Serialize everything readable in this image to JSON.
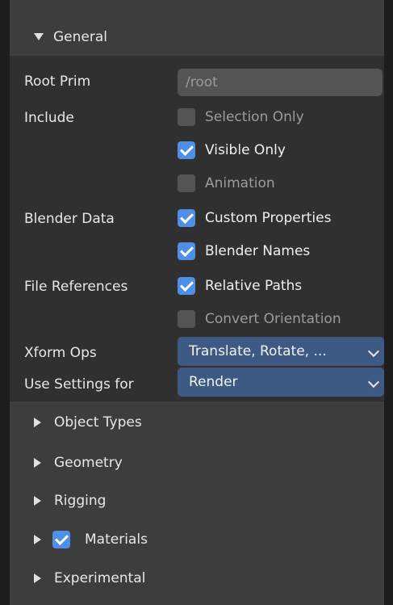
{
  "header": {
    "title": "General"
  },
  "fields": {
    "root_prim_label": "Root Prim",
    "root_prim_value": "/root",
    "include_label": "Include",
    "blender_data_label": "Blender Data",
    "file_references_label": "File References",
    "xform_ops_label": "Xform Ops",
    "xform_ops_value": "Translate, Rotate, ...",
    "use_settings_label": "Use Settings for",
    "use_settings_value": "Render"
  },
  "checkboxes": {
    "selection_only": {
      "label": "Selection Only",
      "checked": false
    },
    "visible_only": {
      "label": "Visible Only",
      "checked": true
    },
    "animation": {
      "label": "Animation",
      "checked": false
    },
    "custom_properties": {
      "label": "Custom Properties",
      "checked": true
    },
    "blender_names": {
      "label": "Blender Names",
      "checked": true
    },
    "relative_paths": {
      "label": "Relative Paths",
      "checked": true
    },
    "convert_orientation": {
      "label": "Convert Orientation",
      "checked": false
    }
  },
  "subpanels": {
    "object_types": "Object Types",
    "geometry": "Geometry",
    "rigging": "Rigging",
    "materials": "Materials",
    "materials_checked": true,
    "experimental": "Experimental"
  },
  "colors": {
    "accent": "#4f8fe6",
    "dropdown_bg": "#3c5a84",
    "panel_bg": "#303030",
    "header_bg": "#3d3d3d"
  }
}
